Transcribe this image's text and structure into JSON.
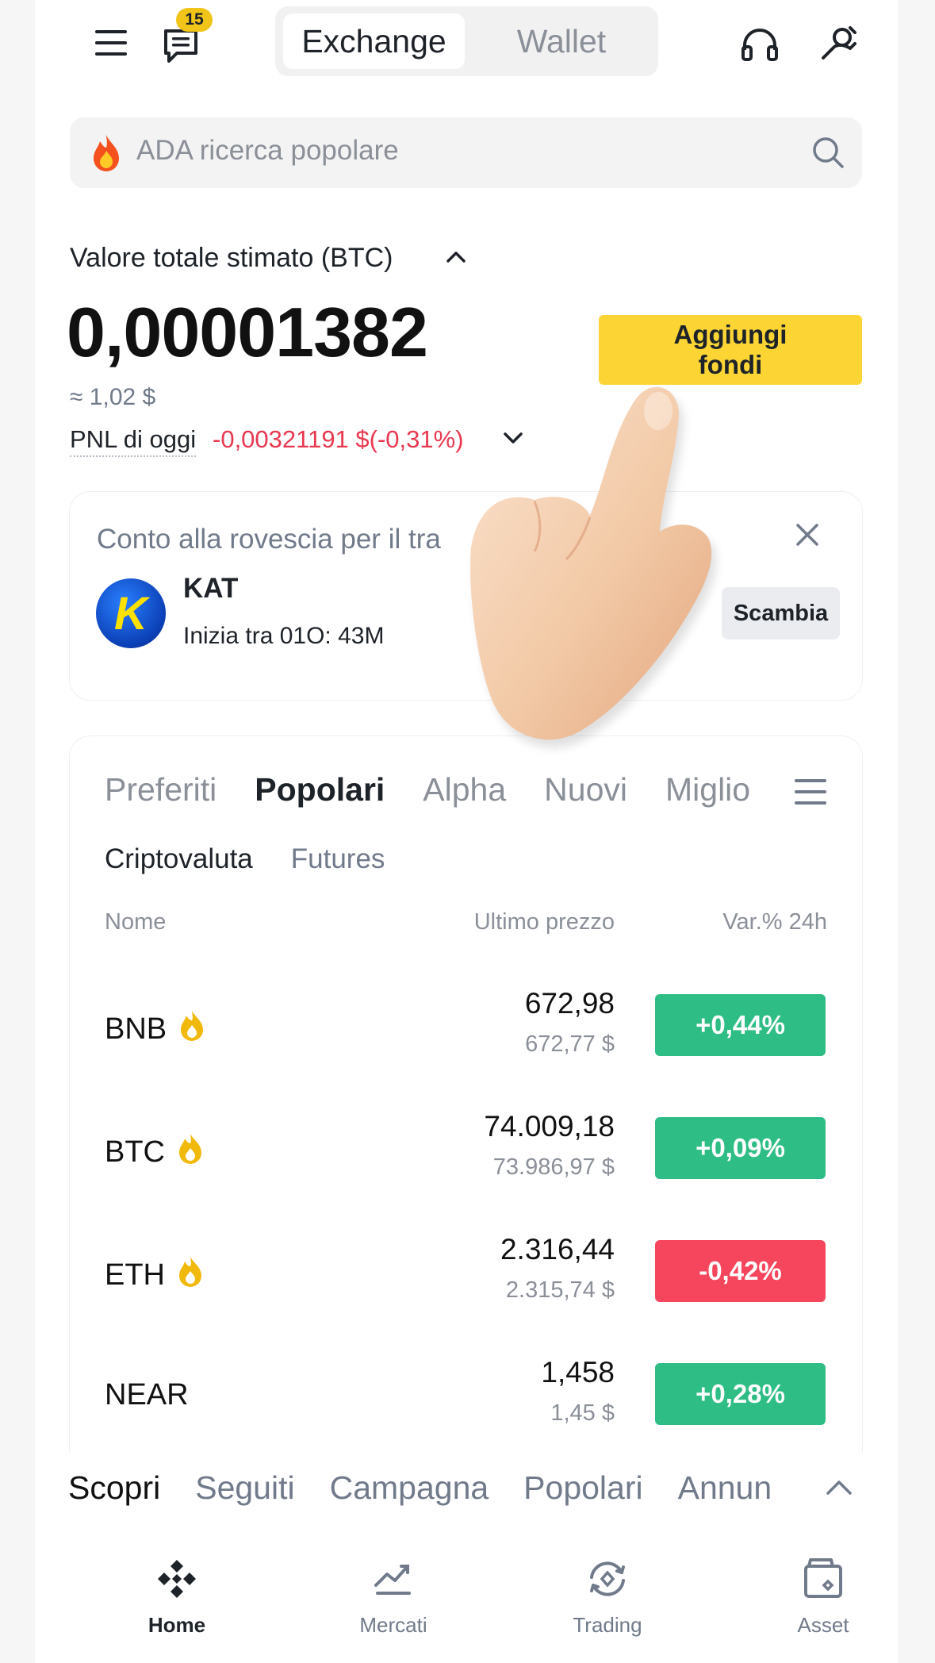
{
  "header": {
    "menu_icon": "menu-icon",
    "messages_icon": "messages-icon",
    "messages_badge": "15",
    "segment": {
      "active": "Exchange",
      "inactive": "Wallet"
    },
    "support_icon": "headset-icon",
    "profile_icon": "profile-edit-icon"
  },
  "search": {
    "icon": "fire-icon",
    "placeholder": "ADA ricerca popolare",
    "search_icon": "search-icon"
  },
  "balance": {
    "label": "Valore totale stimato (BTC)",
    "value": "0,00001382",
    "usd": "≈ 1,02 $",
    "pnl_label": "PNL di oggi",
    "pnl_value": "-0,00321191 $(-0,31%)",
    "add_funds": "Aggiungi\nfondi"
  },
  "countdown_card": {
    "title": "Conto alla rovescia per il tra",
    "token": "KAT",
    "subtitle": "Inizia tra  01O: 43M",
    "button": "Scambia",
    "logo_letter": "K"
  },
  "market": {
    "tabs": [
      "Preferiti",
      "Popolari",
      "Alpha",
      "Nuovi",
      "Miglio"
    ],
    "active_tab": "Popolari",
    "subtabs": [
      "Criptovaluta",
      "Futures"
    ],
    "active_subtab": "Criptovaluta",
    "columns": {
      "name": "Nome",
      "price": "Ultimo prezzo",
      "change": "Var.% 24h"
    },
    "rows": [
      {
        "symbol": "BNB",
        "hot": true,
        "price": "672,98",
        "usd": "672,77 $",
        "change": "+0,44%",
        "dir": "up"
      },
      {
        "symbol": "BTC",
        "hot": true,
        "price": "74.009,18",
        "usd": "73.986,97 $",
        "change": "+0,09%",
        "dir": "up"
      },
      {
        "symbol": "ETH",
        "hot": true,
        "price": "2.316,44",
        "usd": "2.315,74 $",
        "change": "-0,42%",
        "dir": "down"
      },
      {
        "symbol": "NEAR",
        "hot": false,
        "price": "1,458",
        "usd": "1,45 $",
        "change": "+0,28%",
        "dir": "up"
      }
    ]
  },
  "discover": {
    "tabs": [
      "Scopri",
      "Seguiti",
      "Campagna",
      "Popolari",
      "Annun"
    ],
    "active": "Scopri"
  },
  "nav": {
    "items": [
      {
        "label": "Home",
        "icon": "binance-logo-icon",
        "active": true
      },
      {
        "label": "Mercati",
        "icon": "chart-icon",
        "active": false
      },
      {
        "label": "Trading",
        "icon": "trade-icon",
        "active": false
      },
      {
        "label": "Asset",
        "icon": "wallet-icon",
        "active": false
      }
    ]
  },
  "colors": {
    "accent": "#FCD535",
    "up": "#2EBD85",
    "down": "#F6465D",
    "badge": "#F0C419"
  }
}
